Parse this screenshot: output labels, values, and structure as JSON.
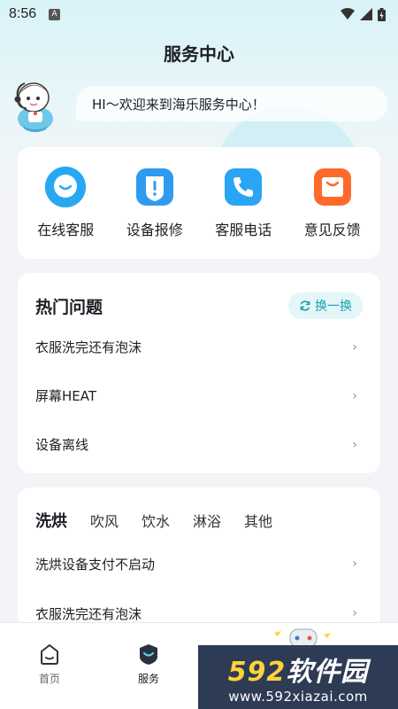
{
  "status_bar": {
    "time": "8:56",
    "badge": "A"
  },
  "header": {
    "title": "服务中心"
  },
  "greeting": {
    "text": "HI～欢迎来到海乐服务中心！"
  },
  "quick_actions": [
    {
      "label": "在线客服",
      "icon": "chat-icon",
      "color": "#29a8f2"
    },
    {
      "label": "设备报修",
      "icon": "repair-alert-icon",
      "color": "#2f9bf0"
    },
    {
      "label": "客服电话",
      "icon": "phone-icon",
      "color": "#2aa4f4"
    },
    {
      "label": "意见反馈",
      "icon": "feedback-icon",
      "color": "#ff6a2b"
    }
  ],
  "hot_questions": {
    "title": "热门问题",
    "refresh_label": "换一换",
    "items": [
      "衣服洗完还有泡沫",
      "屏幕HEAT",
      "设备离线"
    ]
  },
  "categories": {
    "tabs": [
      "洗烘",
      "吹风",
      "饮水",
      "淋浴",
      "其他"
    ],
    "active_tab": "洗烘",
    "items": [
      "洗烘设备支付不启动",
      "衣服洗完还有泡沫"
    ]
  },
  "bottom_nav": {
    "items": [
      {
        "label": "首页",
        "icon": "home-icon"
      },
      {
        "label": "服务",
        "icon": "service-icon"
      }
    ],
    "active": "服务"
  },
  "watermark": {
    "brand_num": "592",
    "brand_text": "软件园",
    "url": "www.592xiazai.com"
  },
  "colors": {
    "accent": "#1a9fb0",
    "background": "#f2f4f7"
  }
}
